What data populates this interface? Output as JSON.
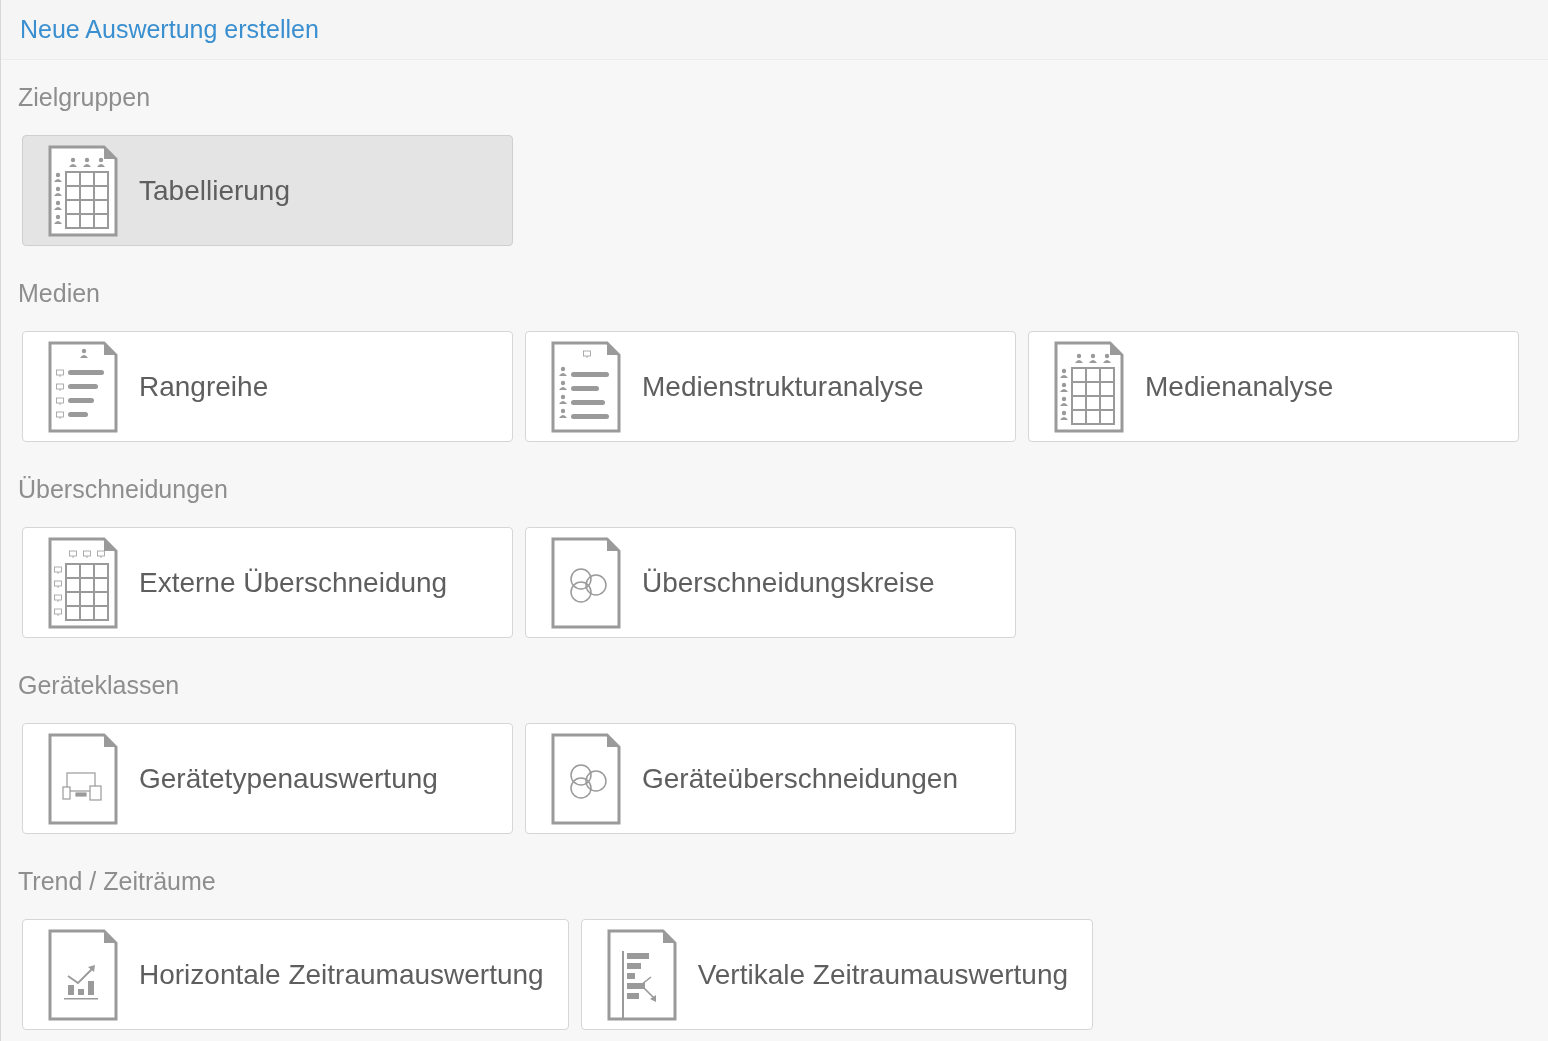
{
  "header": {
    "title": "Neue Auswertung erstellen"
  },
  "sections": [
    {
      "heading": "Zielgruppen",
      "tiles": [
        {
          "label": "Tabellierung",
          "kind": "table-people",
          "selected": true
        }
      ]
    },
    {
      "heading": "Medien",
      "tiles": [
        {
          "label": "Rangreihe",
          "kind": "rank-list",
          "selected": false
        },
        {
          "label": "Medienstrukturanalyse",
          "kind": "people-list",
          "selected": false
        },
        {
          "label": "Medienanalyse",
          "kind": "table-people",
          "selected": false
        }
      ]
    },
    {
      "heading": "Überschneidungen",
      "tiles": [
        {
          "label": "Externe Überschneidung",
          "kind": "table-devices",
          "selected": false
        },
        {
          "label": "Überschneidungskreise",
          "kind": "circles",
          "selected": false
        }
      ]
    },
    {
      "heading": "Geräteklassen",
      "tiles": [
        {
          "label": "Gerätetypenauswertung",
          "kind": "devices",
          "selected": false
        },
        {
          "label": "Geräteüberschneidungen",
          "kind": "circles",
          "selected": false
        }
      ]
    },
    {
      "heading": "Trend / Zeiträume",
      "tiles": [
        {
          "label": "Horizontale Zeitraumauswertung",
          "kind": "chart",
          "selected": false
        },
        {
          "label": "Vertikale Zeitraumauswertung",
          "kind": "bars",
          "selected": false
        }
      ]
    }
  ]
}
